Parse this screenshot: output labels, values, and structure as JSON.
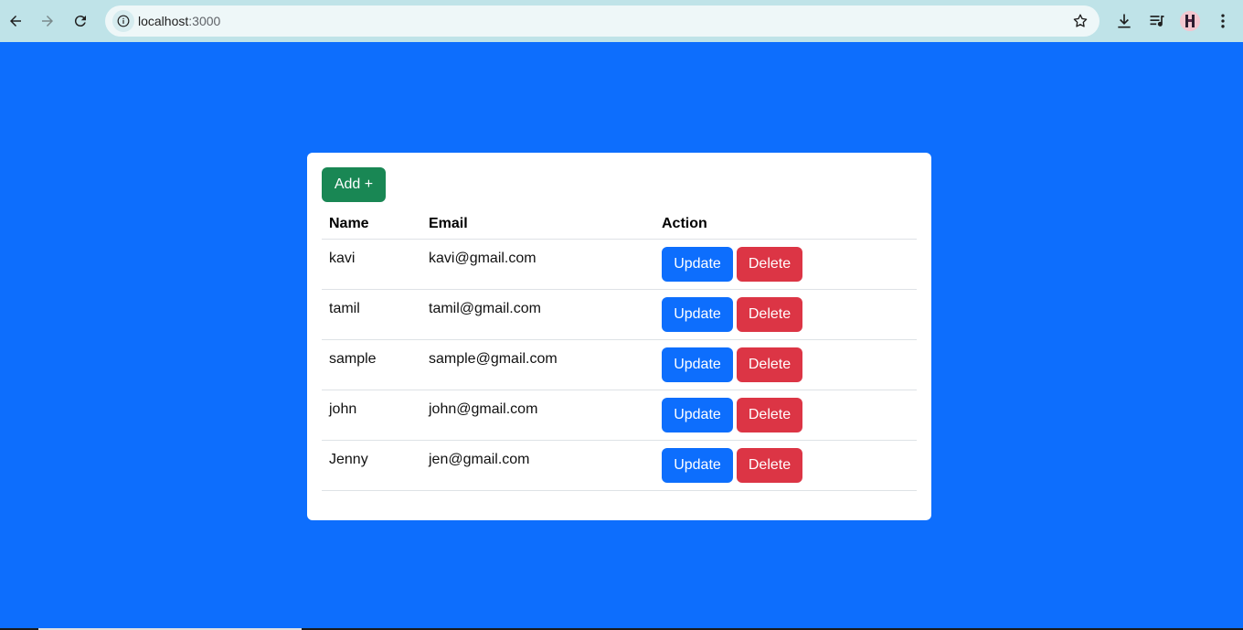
{
  "browser": {
    "url_host": "localhost",
    "url_port": ":3000",
    "icons": [
      "back-arrow-icon",
      "forward-arrow-icon",
      "reload-icon",
      "site-info-icon",
      "bookmark-star-icon",
      "download-icon",
      "media-playlist-icon",
      "profile-avatar",
      "more-menu-icon"
    ]
  },
  "card": {
    "add_label": "Add +",
    "headers": {
      "name": "Name",
      "email": "Email",
      "action": "Action"
    },
    "rows": [
      {
        "name": "kavi",
        "email": "kavi@gmail.com",
        "update": "Update",
        "delete": "Delete"
      },
      {
        "name": "tamil",
        "email": "tamil@gmail.com",
        "update": "Update",
        "delete": "Delete"
      },
      {
        "name": "sample",
        "email": "sample@gmail.com",
        "update": "Update",
        "delete": "Delete"
      },
      {
        "name": "john",
        "email": "john@gmail.com",
        "update": "Update",
        "delete": "Delete"
      },
      {
        "name": "Jenny",
        "email": "jen@gmail.com",
        "update": "Update",
        "delete": "Delete"
      }
    ]
  },
  "colors": {
    "background": "#0d6efd",
    "add_button": "#198754",
    "update_button": "#0d6efd",
    "delete_button": "#dc3545",
    "chrome": "#bfe3e8"
  }
}
